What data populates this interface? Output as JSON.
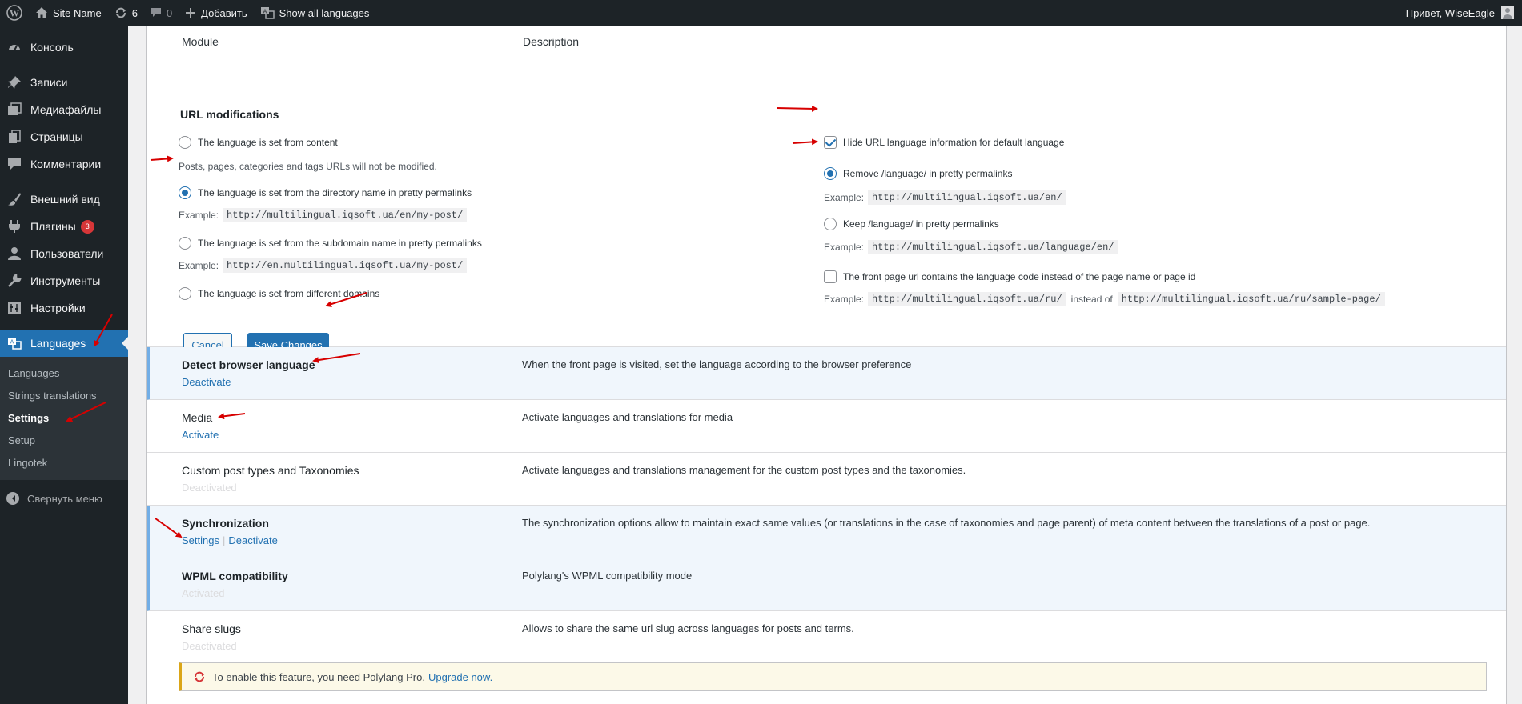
{
  "adminbar": {
    "site_name": "Site Name",
    "updates_count": "6",
    "comments_count": "0",
    "add_new": "Добавить",
    "show_all_languages": "Show all languages",
    "greeting": "Привет, WiseEagle"
  },
  "sidebar": {
    "items": [
      {
        "label": "Консоль",
        "icon": "dashboard-icon"
      },
      {
        "label": "Записи",
        "icon": "pin-icon"
      },
      {
        "label": "Медиафайлы",
        "icon": "media-icon"
      },
      {
        "label": "Страницы",
        "icon": "pages-icon"
      },
      {
        "label": "Комментарии",
        "icon": "comment-icon"
      },
      {
        "label": "Внешний вид",
        "icon": "brush-icon"
      },
      {
        "label": "Плагины",
        "icon": "plugin-icon",
        "badge": "3"
      },
      {
        "label": "Пользователи",
        "icon": "users-icon"
      },
      {
        "label": "Инструменты",
        "icon": "wrench-icon"
      },
      {
        "label": "Настройки",
        "icon": "settings-icon"
      },
      {
        "label": "Languages",
        "icon": "translation-icon"
      }
    ],
    "submenu": [
      "Languages",
      "Strings translations",
      "Settings",
      "Setup",
      "Lingotek"
    ],
    "collapse": "Свернуть меню"
  },
  "table": {
    "col_module": "Module",
    "col_description": "Description"
  },
  "url": {
    "title": "URL modifications",
    "opt_content": "The language is set from content",
    "opt_content_note": "Posts, pages, categories and tags URLs will not be modified.",
    "opt_directory": "The language is set from the directory name in pretty permalinks",
    "example_label": "Example:",
    "opt_directory_example": "http://multilingual.iqsoft.ua/en/my-post/",
    "opt_subdomain": "The language is set from the subdomain name in pretty permalinks",
    "opt_subdomain_example": "http://en.multilingual.iqsoft.ua/my-post/",
    "opt_domains": "The language is set from different domains",
    "hide_default": "Hide URL language information for default language",
    "remove_language": "Remove /language/ in pretty permalinks",
    "remove_example": "http://multilingual.iqsoft.ua/en/",
    "keep_language": "Keep /language/ in pretty permalinks",
    "keep_example": "http://multilingual.iqsoft.ua/language/en/",
    "front_page": "The front page url contains the language code instead of the page name or page id",
    "front_example_1": "http://multilingual.iqsoft.ua/ru/",
    "instead_of": "instead of",
    "front_example_2": "http://multilingual.iqsoft.ua/ru/sample-page/",
    "cancel": "Cancel",
    "save": "Save Changes"
  },
  "modules": [
    {
      "name": "Detect browser language",
      "action": "Deactivate",
      "desc": "When the front page is visited, set the language according to the browser preference"
    },
    {
      "name": "Media",
      "action": "Activate",
      "desc": "Activate languages and translations for media"
    },
    {
      "name": "Custom post types and Taxonomies",
      "action": "Deactivated",
      "desc": "Activate languages and translations management for the custom post types and the taxonomies."
    },
    {
      "name": "Synchronization",
      "action_settings": "Settings",
      "action": "Deactivate",
      "desc": "The synchronization options allow to maintain exact same values (or translations in the case of taxonomies and page parent) of meta content between the translations of a post or page."
    },
    {
      "name": "WPML compatibility",
      "action": "Activated",
      "desc": "Polylang's WPML compatibility mode"
    },
    {
      "name": "Share slugs",
      "action": "Deactivated",
      "desc": "Allows to share the same url slug across languages for posts and terms."
    }
  ],
  "pro_notice": {
    "text": "To enable this feature, you need Polylang Pro.",
    "link": "Upgrade now."
  },
  "colors": {
    "accent": "#2271b1",
    "adminbar": "#1d2327",
    "annotation": "#d70000"
  }
}
